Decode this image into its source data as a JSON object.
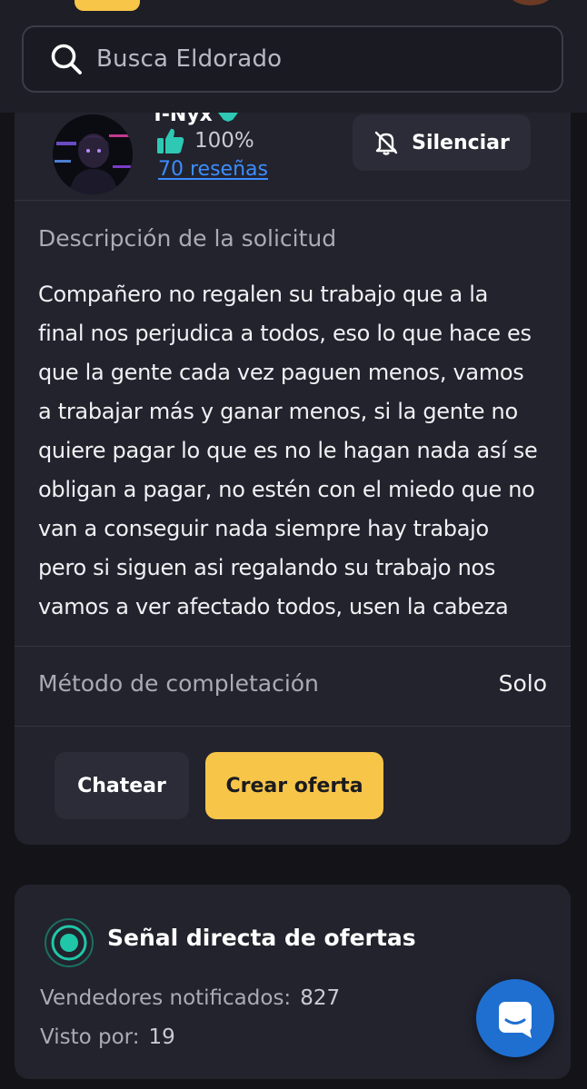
{
  "header": {
    "search_placeholder": "Busca Eldorado",
    "icons": {
      "search": "search-icon"
    }
  },
  "seller": {
    "name": "T-Nyx",
    "rating": "100%",
    "reviews_link": "70 reseñas",
    "mute_label": "Silenciar",
    "icons": {
      "thumb": "thumbs-up-icon",
      "verified": "verified-badge-icon",
      "mute": "bell-off-icon"
    }
  },
  "request": {
    "description_heading": "Descripción de la solicitud",
    "description_lines": [
      "Compañero no regalen su trabajo que a la",
      "final nos perjudica a todos, eso lo que hace es",
      "que la gente cada vez paguen menos, vamos",
      "a trabajar más y ganar menos, si la gente no",
      "quiere pagar lo que es no le hagan nada así se",
      "obligan a pagar, no estén con el miedo que no",
      "van a conseguir nada siempre hay trabajo",
      "pero si siguen asi regalando su trabajo nos",
      "vamos a ver afectado todos, usen la cabeza"
    ],
    "method_label": "Método de completación",
    "method_value": "Solo",
    "chat_button": "Chatear",
    "offer_button": "Crear oferta"
  },
  "signal": {
    "title": "Señal directa de ofertas",
    "notified_label": "Vendedores notificados:",
    "notified_count": "827",
    "seen_label": "Visto por:",
    "seen_count": "19",
    "icons": {
      "signal": "radio-signal-icon",
      "help": "chat-support-icon"
    }
  },
  "colors": {
    "background": "#141418",
    "card": "#22232d",
    "accent_yellow": "#f7c548",
    "link_blue": "#3d8cff",
    "signal_teal": "#1fc7a8",
    "fab_blue": "#1f6fd1"
  }
}
